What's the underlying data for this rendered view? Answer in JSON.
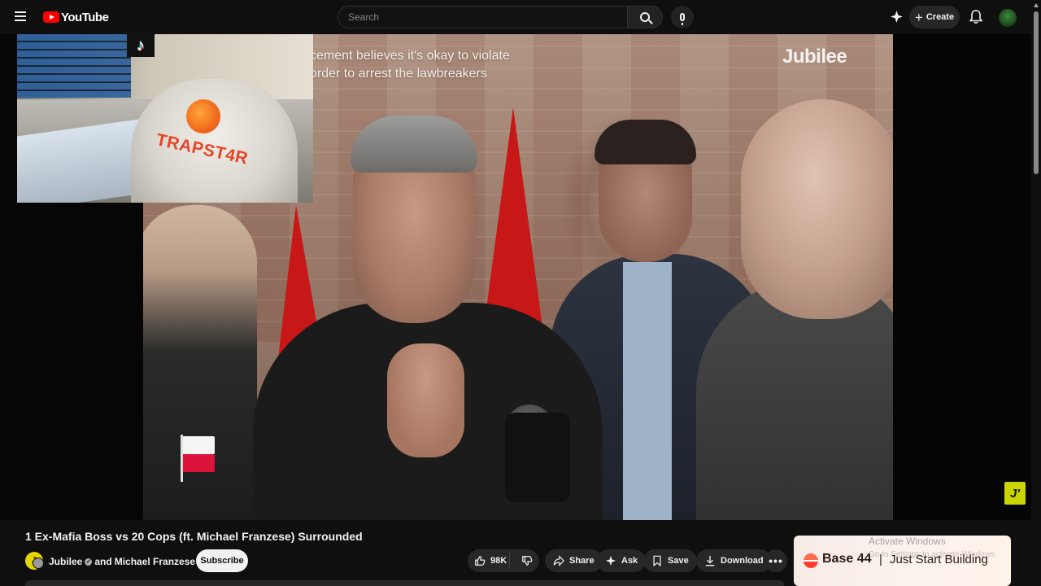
{
  "topbar": {
    "logo_text": "YouTube",
    "search_placeholder": "Search",
    "create_label": "Create"
  },
  "video": {
    "caption_line1": "cement believes it's okay to violate",
    "caption_line2": "order to arrest the lawbreakers",
    "brand_watermark": "Jubilee",
    "webcam_shirt_text": "TRAPST4R",
    "corner_badge_text": "J'"
  },
  "info": {
    "title": "1 Ex-Mafia Boss vs 20 Cops (ft. Michael Franzese) Surrounded",
    "channel_primary": "Jubilee",
    "channel_joiner": "and",
    "channel_secondary": "Michael Franzese",
    "subscribe_label": "Subscribe",
    "like_count": "98K",
    "share_label": "Share",
    "ask_label": "Ask",
    "save_label": "Save",
    "download_label": "Download",
    "more_label": "•••"
  },
  "ad": {
    "brand": "Base 44",
    "separator": "|",
    "tagline": "Just Start Building"
  },
  "os_overlay": {
    "activate_title": "Activate Windows",
    "activate_sub": "Go to Settings to activate Windows."
  },
  "colors": {
    "background": "#0f0f0f",
    "accent_red": "#ff0000",
    "button_bg": "#272727",
    "subscribe_bg": "#f1f1f1"
  }
}
